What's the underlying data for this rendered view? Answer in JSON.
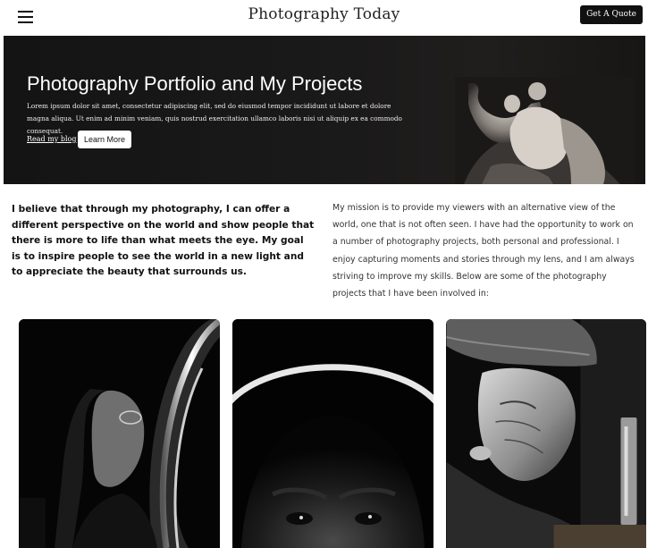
{
  "header": {
    "site_title": "Photography Today",
    "quote_button": "Get A Quote",
    "menu_icon": "hamburger-menu-icon"
  },
  "hero": {
    "title": "Photography Portfolio and My Projects",
    "text": "Lorem ipsum dolor sit amet, consectetur adipiscing elit, sed do eiusmod tempor incididunt ut labore et dolore magna aliqua. Ut enim ad minim veniam, quis nostrud exercitation ullamco laboris nisi ut aliquip ex ea commodo consequat.",
    "blog_link": "Read my blog",
    "learn_more": "Learn More"
  },
  "intro": {
    "statement": "I believe that through my photography, I can offer a different perspective on the world and show people that there is more to life than what meets the eye. My goal is to inspire people to see the world in a new light and to appreciate the beauty that surrounds us.",
    "mission": "My mission is to provide my viewers with an alternative view of the world, one that is not often seen. I have had the opportunity to work on a number of photography projects, both personal and professional. I enjoy capturing moments and stories through my lens, and I am always striving to improve my skills. Below are some of the photography projects that I have been involved in:"
  },
  "colors": {
    "header_bg": "#ffffff",
    "hero_bg": "#141414",
    "button_dark": "#111111",
    "button_light": "#ffffff"
  }
}
